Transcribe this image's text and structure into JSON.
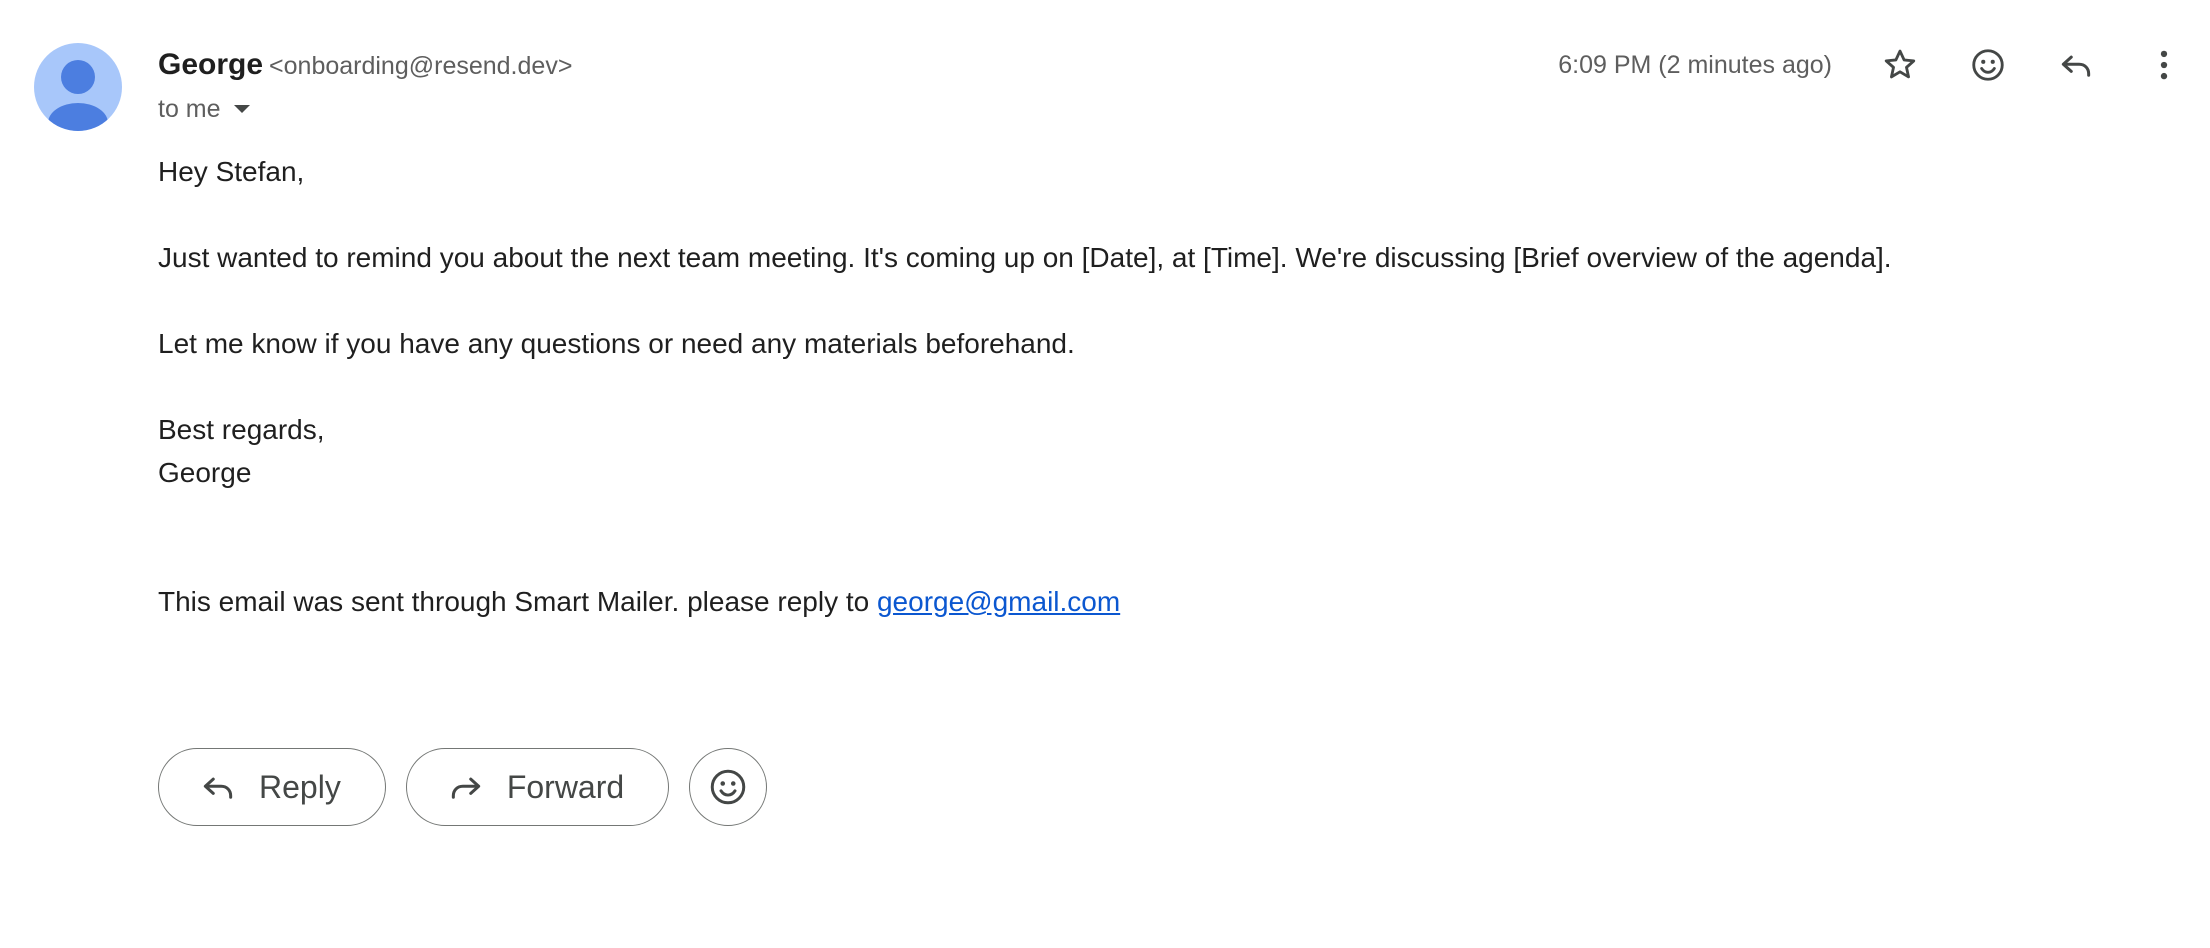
{
  "sender": {
    "name": "George",
    "email": "<onboarding@resend.dev>"
  },
  "recipient": {
    "label": "to me"
  },
  "timestamp": "6:09 PM (2 minutes ago)",
  "header_actions": {
    "icons": [
      "star-icon",
      "emoji-icon",
      "reply-icon",
      "more-vert-icon"
    ]
  },
  "message": {
    "greeting": "Hey Stefan,",
    "paragraph1": "Just wanted to remind you about the next team meeting. It's coming up on [Date], at [Time]. We're discussing [Brief overview of the agenda].",
    "paragraph2": "Let me know if you have any questions or need any materials beforehand.",
    "signoff": "Best regards,",
    "signature": "George",
    "footer_text": "This email was sent through Smart Mailer. please reply to",
    "footer_link": "george@gmail.com"
  },
  "actions": {
    "reply_label": "Reply",
    "forward_label": "Forward"
  },
  "colors": {
    "avatar_bg": "#a8c7fa",
    "avatar_fg": "#4c7ee0",
    "link": "#0b57d0",
    "text_primary": "#1f1f1f",
    "text_secondary": "#5e5e5e",
    "icon": "#444746"
  }
}
